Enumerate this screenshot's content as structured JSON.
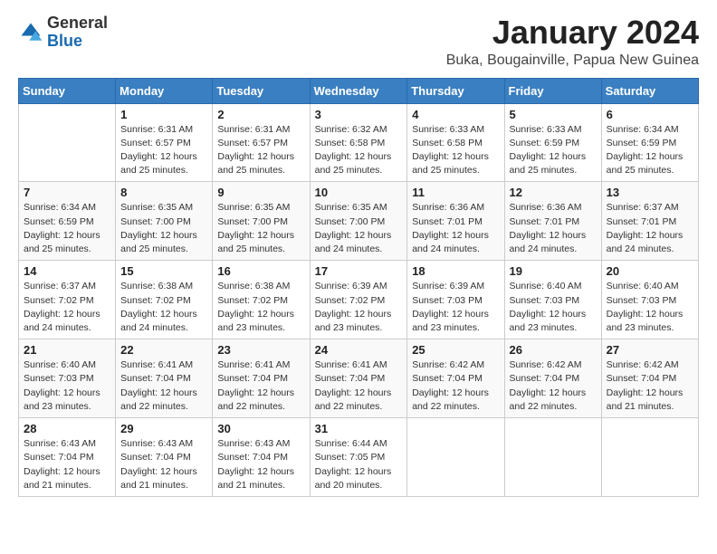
{
  "logo": {
    "general": "General",
    "blue": "Blue"
  },
  "header": {
    "month_year": "January 2024",
    "location": "Buka, Bougainville, Papua New Guinea"
  },
  "weekdays": [
    "Sunday",
    "Monday",
    "Tuesday",
    "Wednesday",
    "Thursday",
    "Friday",
    "Saturday"
  ],
  "weeks": [
    [
      {
        "day": "",
        "sunrise": "",
        "sunset": "",
        "daylight": ""
      },
      {
        "day": "1",
        "sunrise": "Sunrise: 6:31 AM",
        "sunset": "Sunset: 6:57 PM",
        "daylight": "Daylight: 12 hours and 25 minutes."
      },
      {
        "day": "2",
        "sunrise": "Sunrise: 6:31 AM",
        "sunset": "Sunset: 6:57 PM",
        "daylight": "Daylight: 12 hours and 25 minutes."
      },
      {
        "day": "3",
        "sunrise": "Sunrise: 6:32 AM",
        "sunset": "Sunset: 6:58 PM",
        "daylight": "Daylight: 12 hours and 25 minutes."
      },
      {
        "day": "4",
        "sunrise": "Sunrise: 6:33 AM",
        "sunset": "Sunset: 6:58 PM",
        "daylight": "Daylight: 12 hours and 25 minutes."
      },
      {
        "day": "5",
        "sunrise": "Sunrise: 6:33 AM",
        "sunset": "Sunset: 6:59 PM",
        "daylight": "Daylight: 12 hours and 25 minutes."
      },
      {
        "day": "6",
        "sunrise": "Sunrise: 6:34 AM",
        "sunset": "Sunset: 6:59 PM",
        "daylight": "Daylight: 12 hours and 25 minutes."
      }
    ],
    [
      {
        "day": "7",
        "sunrise": "Sunrise: 6:34 AM",
        "sunset": "Sunset: 6:59 PM",
        "daylight": "Daylight: 12 hours and 25 minutes."
      },
      {
        "day": "8",
        "sunrise": "Sunrise: 6:35 AM",
        "sunset": "Sunset: 7:00 PM",
        "daylight": "Daylight: 12 hours and 25 minutes."
      },
      {
        "day": "9",
        "sunrise": "Sunrise: 6:35 AM",
        "sunset": "Sunset: 7:00 PM",
        "daylight": "Daylight: 12 hours and 25 minutes."
      },
      {
        "day": "10",
        "sunrise": "Sunrise: 6:35 AM",
        "sunset": "Sunset: 7:00 PM",
        "daylight": "Daylight: 12 hours and 24 minutes."
      },
      {
        "day": "11",
        "sunrise": "Sunrise: 6:36 AM",
        "sunset": "Sunset: 7:01 PM",
        "daylight": "Daylight: 12 hours and 24 minutes."
      },
      {
        "day": "12",
        "sunrise": "Sunrise: 6:36 AM",
        "sunset": "Sunset: 7:01 PM",
        "daylight": "Daylight: 12 hours and 24 minutes."
      },
      {
        "day": "13",
        "sunrise": "Sunrise: 6:37 AM",
        "sunset": "Sunset: 7:01 PM",
        "daylight": "Daylight: 12 hours and 24 minutes."
      }
    ],
    [
      {
        "day": "14",
        "sunrise": "Sunrise: 6:37 AM",
        "sunset": "Sunset: 7:02 PM",
        "daylight": "Daylight: 12 hours and 24 minutes."
      },
      {
        "day": "15",
        "sunrise": "Sunrise: 6:38 AM",
        "sunset": "Sunset: 7:02 PM",
        "daylight": "Daylight: 12 hours and 24 minutes."
      },
      {
        "day": "16",
        "sunrise": "Sunrise: 6:38 AM",
        "sunset": "Sunset: 7:02 PM",
        "daylight": "Daylight: 12 hours and 23 minutes."
      },
      {
        "day": "17",
        "sunrise": "Sunrise: 6:39 AM",
        "sunset": "Sunset: 7:02 PM",
        "daylight": "Daylight: 12 hours and 23 minutes."
      },
      {
        "day": "18",
        "sunrise": "Sunrise: 6:39 AM",
        "sunset": "Sunset: 7:03 PM",
        "daylight": "Daylight: 12 hours and 23 minutes."
      },
      {
        "day": "19",
        "sunrise": "Sunrise: 6:40 AM",
        "sunset": "Sunset: 7:03 PM",
        "daylight": "Daylight: 12 hours and 23 minutes."
      },
      {
        "day": "20",
        "sunrise": "Sunrise: 6:40 AM",
        "sunset": "Sunset: 7:03 PM",
        "daylight": "Daylight: 12 hours and 23 minutes."
      }
    ],
    [
      {
        "day": "21",
        "sunrise": "Sunrise: 6:40 AM",
        "sunset": "Sunset: 7:03 PM",
        "daylight": "Daylight: 12 hours and 23 minutes."
      },
      {
        "day": "22",
        "sunrise": "Sunrise: 6:41 AM",
        "sunset": "Sunset: 7:04 PM",
        "daylight": "Daylight: 12 hours and 22 minutes."
      },
      {
        "day": "23",
        "sunrise": "Sunrise: 6:41 AM",
        "sunset": "Sunset: 7:04 PM",
        "daylight": "Daylight: 12 hours and 22 minutes."
      },
      {
        "day": "24",
        "sunrise": "Sunrise: 6:41 AM",
        "sunset": "Sunset: 7:04 PM",
        "daylight": "Daylight: 12 hours and 22 minutes."
      },
      {
        "day": "25",
        "sunrise": "Sunrise: 6:42 AM",
        "sunset": "Sunset: 7:04 PM",
        "daylight": "Daylight: 12 hours and 22 minutes."
      },
      {
        "day": "26",
        "sunrise": "Sunrise: 6:42 AM",
        "sunset": "Sunset: 7:04 PM",
        "daylight": "Daylight: 12 hours and 22 minutes."
      },
      {
        "day": "27",
        "sunrise": "Sunrise: 6:42 AM",
        "sunset": "Sunset: 7:04 PM",
        "daylight": "Daylight: 12 hours and 21 minutes."
      }
    ],
    [
      {
        "day": "28",
        "sunrise": "Sunrise: 6:43 AM",
        "sunset": "Sunset: 7:04 PM",
        "daylight": "Daylight: 12 hours and 21 minutes."
      },
      {
        "day": "29",
        "sunrise": "Sunrise: 6:43 AM",
        "sunset": "Sunset: 7:04 PM",
        "daylight": "Daylight: 12 hours and 21 minutes."
      },
      {
        "day": "30",
        "sunrise": "Sunrise: 6:43 AM",
        "sunset": "Sunset: 7:04 PM",
        "daylight": "Daylight: 12 hours and 21 minutes."
      },
      {
        "day": "31",
        "sunrise": "Sunrise: 6:44 AM",
        "sunset": "Sunset: 7:05 PM",
        "daylight": "Daylight: 12 hours and 20 minutes."
      },
      {
        "day": "",
        "sunrise": "",
        "sunset": "",
        "daylight": ""
      },
      {
        "day": "",
        "sunrise": "",
        "sunset": "",
        "daylight": ""
      },
      {
        "day": "",
        "sunrise": "",
        "sunset": "",
        "daylight": ""
      }
    ]
  ]
}
